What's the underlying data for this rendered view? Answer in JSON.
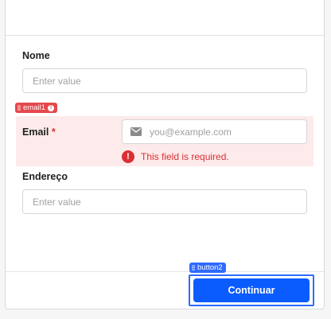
{
  "form": {
    "fields": [
      {
        "label": "Nome",
        "placeholder": "Enter value"
      },
      {
        "label": "Email",
        "required_marker": "*",
        "placeholder": "you@example.com",
        "error": "This field is required.",
        "component_tag": "email1",
        "icon": "mail-icon"
      },
      {
        "label": "Endereço",
        "placeholder": "Enter value"
      }
    ],
    "submit": {
      "label": "Continuar",
      "component_tag": "button2"
    }
  },
  "colors": {
    "primary": "#0b5cff",
    "selection": "#2f6bff",
    "error": "#d93036",
    "error_bg": "#fdeaea"
  }
}
